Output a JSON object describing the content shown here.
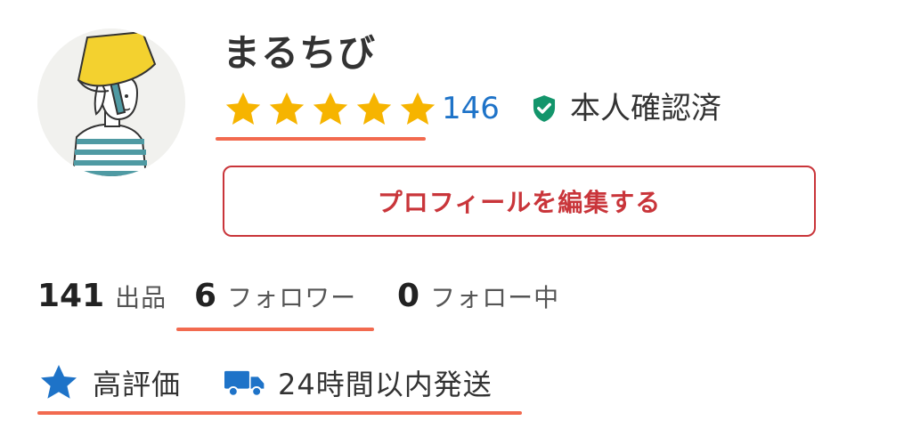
{
  "profile": {
    "username": "まるちび",
    "rating_stars": 5,
    "rating_count": "146",
    "verified_label": "本人確認済",
    "edit_button_label": "プロフィールを編集する"
  },
  "stats": [
    {
      "value": "141",
      "label": "出品"
    },
    {
      "value": "6",
      "label": "フォロワー"
    },
    {
      "value": "0",
      "label": "フォロー中"
    }
  ],
  "badges": [
    {
      "icon": "star-icon",
      "label": "高評価"
    },
    {
      "icon": "truck-icon",
      "label": "24時間以内発送"
    }
  ],
  "colors": {
    "star": "#f6b400",
    "rating_link": "#1e73c8",
    "verified_shield": "#13956b",
    "edit_button": "#c9353a",
    "badge_icon": "#1e73c8",
    "highlight_underline": "#f26a4f"
  }
}
